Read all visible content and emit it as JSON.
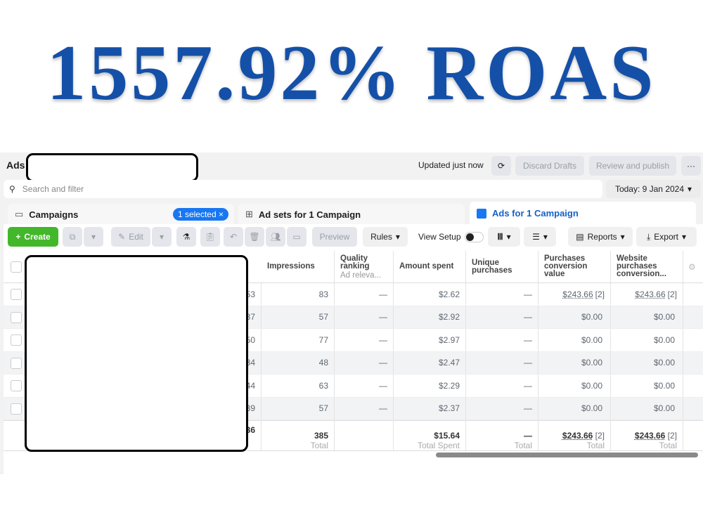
{
  "headline": "1557.92% ROAS",
  "header": {
    "title": "Ads",
    "updated": "Updated just now",
    "discard": "Discard Drafts",
    "review": "Review and publish",
    "more": "···"
  },
  "search": {
    "placeholder": "Search and filter",
    "date": "Today: 9 Jan 2024"
  },
  "tabs": {
    "campaigns": "Campaigns",
    "selected": "1 selected",
    "adsets": "Ad sets for 1 Campaign",
    "ads": "Ads for 1 Campaign"
  },
  "toolbar": {
    "create": "Create",
    "edit": "Edit",
    "preview": "Preview",
    "rules": "Rules",
    "view_setup": "View Setup",
    "reports": "Reports",
    "export": "Export"
  },
  "columns": {
    "impressions": "Impressions",
    "quality": "Quality ranking",
    "quality_sub": "Ad releva...",
    "amount": "Amount spent",
    "unique": "Unique purchases",
    "pcv": "Purchases conversion value",
    "website": "Website purchases conversion..."
  },
  "rows": [
    {
      "partial": "53",
      "impressions": "83",
      "quality": "—",
      "amount": "$2.62",
      "unique": "—",
      "pcv": "$243.66",
      "pcv_n": "[2]",
      "web": "$243.66",
      "web_n": "[2]"
    },
    {
      "partial": "37",
      "impressions": "57",
      "quality": "—",
      "amount": "$2.92",
      "unique": "—",
      "pcv": "$0.00",
      "pcv_n": "",
      "web": "$0.00",
      "web_n": ""
    },
    {
      "partial": "50",
      "impressions": "77",
      "quality": "—",
      "amount": "$2.97",
      "unique": "—",
      "pcv": "$0.00",
      "pcv_n": "",
      "web": "$0.00",
      "web_n": ""
    },
    {
      "partial": "34",
      "impressions": "48",
      "quality": "—",
      "amount": "$2.47",
      "unique": "—",
      "pcv": "$0.00",
      "pcv_n": "",
      "web": "$0.00",
      "web_n": ""
    },
    {
      "partial": "44",
      "impressions": "63",
      "quality": "—",
      "amount": "$2.29",
      "unique": "—",
      "pcv": "$0.00",
      "pcv_n": "",
      "web": "$0.00",
      "web_n": ""
    },
    {
      "partial": "39",
      "impressions": "57",
      "quality": "—",
      "amount": "$2.37",
      "unique": "—",
      "pcv": "$0.00",
      "pcv_n": "",
      "web": "$0.00",
      "web_n": ""
    }
  ],
  "totals": {
    "partial": "36",
    "impressions": "385",
    "impressions_l": "Total",
    "amount": "$15.64",
    "amount_l": "Total Spent",
    "unique": "—",
    "unique_l": "Total",
    "pcv": "$243.66",
    "pcv_n": "[2]",
    "pcv_l": "Total",
    "web": "$243.66",
    "web_n": "[2]",
    "web_l": "Total"
  }
}
